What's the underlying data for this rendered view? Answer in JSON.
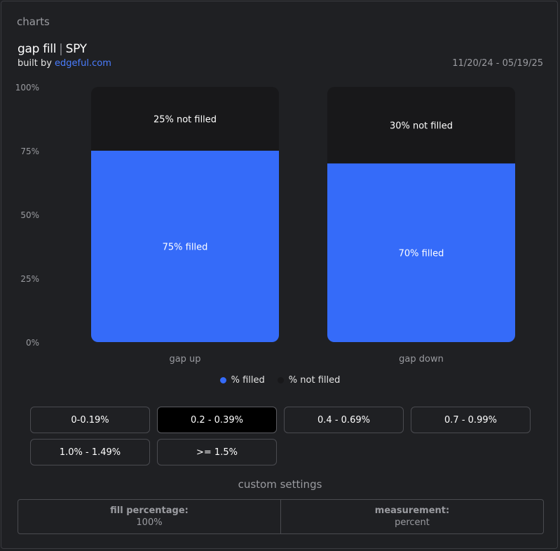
{
  "section_title": "charts",
  "header": {
    "title": "gap fill",
    "separator": "|",
    "ticker": "SPY",
    "built_by_prefix": "built by",
    "built_by_link": "edgeful.com",
    "date_range": "11/20/24 - 05/19/25"
  },
  "colors": {
    "filled": "#356bf9",
    "not_filled": "#18181a",
    "background": "#1f2023"
  },
  "chart_data": {
    "type": "bar",
    "stacked": true,
    "categories": [
      "gap up",
      "gap down"
    ],
    "series": [
      {
        "name": "% filled",
        "values": [
          75,
          70
        ],
        "labels": [
          "75% filled",
          "70% filled"
        ]
      },
      {
        "name": "% not filled",
        "values": [
          25,
          30
        ],
        "labels": [
          "25% not filled",
          "30% not filled"
        ]
      }
    ],
    "ylim": [
      0,
      100
    ],
    "yticks": [
      0,
      25,
      50,
      75,
      100
    ],
    "ytick_labels": [
      "0%",
      "25%",
      "50%",
      "75%",
      "100%"
    ],
    "legend_position": "bottom-center"
  },
  "legend": {
    "filled_label": "% filled",
    "not_filled_label": "% not filled"
  },
  "filters": [
    {
      "label": "0-0.19%",
      "active": false
    },
    {
      "label": "0.2 - 0.39%",
      "active": true
    },
    {
      "label": "0.4 - 0.69%",
      "active": false
    },
    {
      "label": "0.7 - 0.99%",
      "active": false
    },
    {
      "label": "1.0% - 1.49%",
      "active": false
    },
    {
      "label": ">= 1.5%",
      "active": false
    }
  ],
  "custom_settings": {
    "title": "custom settings",
    "fill_percentage_label": "fill percentage:",
    "fill_percentage_value": "100%",
    "measurement_label": "measurement:",
    "measurement_value": "percent"
  }
}
